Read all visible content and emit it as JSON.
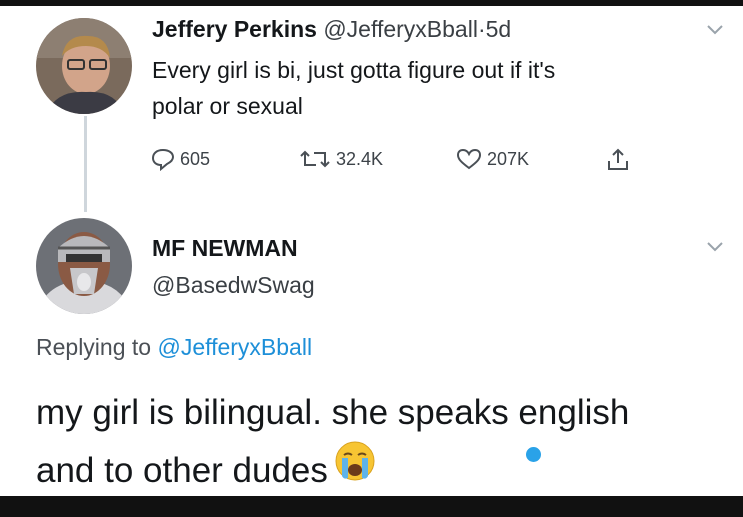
{
  "tweet1": {
    "name": "Jeffery Perkins",
    "handle": "@JefferyxBball",
    "separator": "·",
    "time": "5d",
    "text_line1": "Every girl is bi, just gotta figure out if it's",
    "text_line2": "polar or sexual",
    "replies": "605",
    "retweets": "32.4K",
    "likes": "207K"
  },
  "tweet2": {
    "name": "MF NEWMAN",
    "handle": "@BasedwSwag",
    "replying_prefix": "Replying to",
    "replying_to": "@JefferyxBball",
    "text_line1": "my girl is bilingual. she speaks english",
    "text_line2": "and to other dudes",
    "emoji": "crying-face"
  },
  "colors": {
    "link": "#1d8fd8",
    "text": "#14171a",
    "muted": "#3a3f44",
    "dot": "#2aa2e8"
  }
}
